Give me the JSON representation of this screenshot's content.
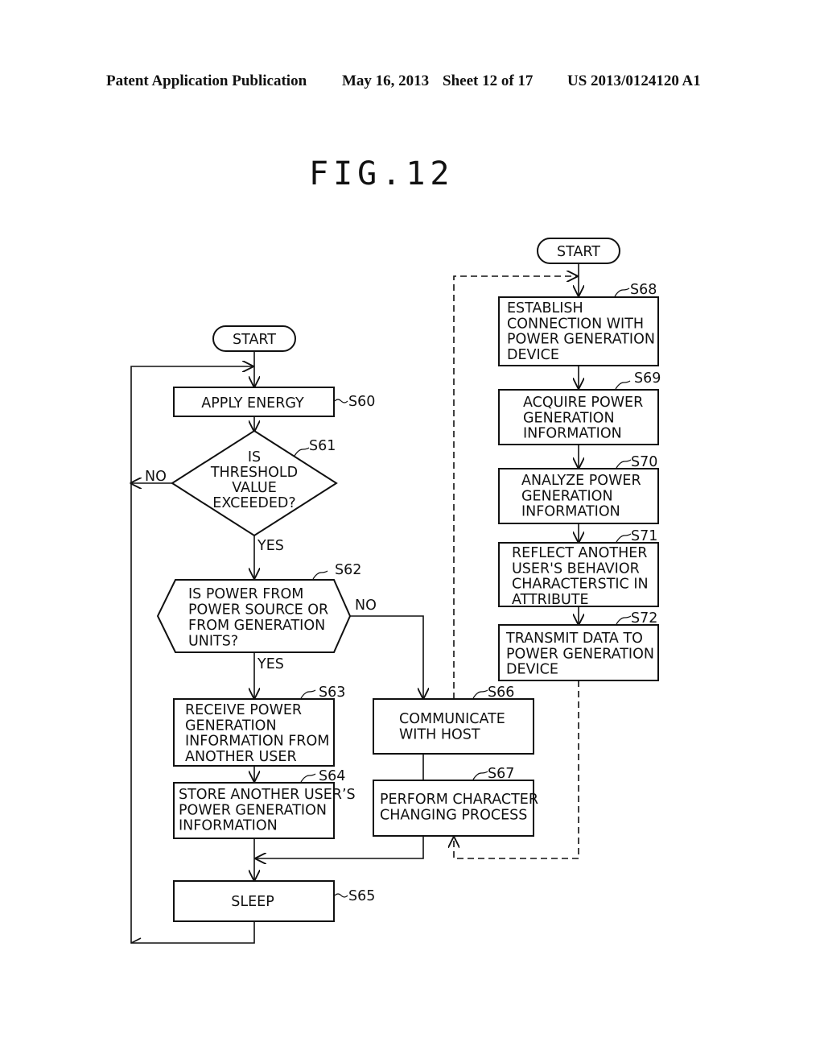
{
  "header": {
    "publication": "Patent Application Publication",
    "date": "May 16, 2013",
    "sheet": "Sheet 12 of 17",
    "number": "US 2013/0124120 A1"
  },
  "figure_title": "FIG.12",
  "left_flow": {
    "start": "START",
    "s60": {
      "label": "S60",
      "lines": [
        "APPLY ENERGY"
      ]
    },
    "s61": {
      "label": "S61",
      "lines": [
        "IS",
        "THRESHOLD",
        "VALUE",
        "EXCEEDED?"
      ],
      "no": "NO",
      "yes": "YES"
    },
    "s62": {
      "label": "S62",
      "lines": [
        "IS POWER FROM",
        "POWER SOURCE OR",
        "FROM GENERATION",
        "UNITS?"
      ],
      "no": "NO",
      "yes": "YES"
    },
    "s63": {
      "label": "S63",
      "lines": [
        "RECEIVE POWER",
        "GENERATION",
        "INFORMATION FROM",
        "ANOTHER USER"
      ]
    },
    "s64": {
      "label": "S64",
      "lines": [
        "STORE ANOTHER USER’S",
        "POWER GENERATION",
        "INFORMATION"
      ]
    },
    "s65": {
      "label": "S65",
      "lines": [
        "SLEEP"
      ]
    },
    "s66": {
      "label": "S66",
      "lines": [
        "COMMUNICATE",
        "WITH HOST"
      ]
    },
    "s67": {
      "label": "S67",
      "lines": [
        "PERFORM CHARACTER",
        "CHANGING PROCESS"
      ]
    }
  },
  "right_flow": {
    "start": "START",
    "s68": {
      "label": "S68",
      "lines": [
        "ESTABLISH",
        "CONNECTION WITH",
        "POWER GENERATION",
        "DEVICE"
      ]
    },
    "s69": {
      "label": "S69",
      "lines": [
        "ACQUIRE POWER",
        "GENERATION",
        "INFORMATION"
      ]
    },
    "s70": {
      "label": "S70",
      "lines": [
        "ANALYZE POWER",
        "GENERATION",
        "INFORMATION"
      ]
    },
    "s71": {
      "label": "S71",
      "lines": [
        "REFLECT ANOTHER",
        "USER'S BEHAVIOR",
        "CHARACTERSTIC IN",
        "ATTRIBUTE"
      ]
    },
    "s72": {
      "label": "S72",
      "lines": [
        "TRANSMIT DATA TO",
        "POWER GENERATION",
        "DEVICE"
      ]
    }
  }
}
